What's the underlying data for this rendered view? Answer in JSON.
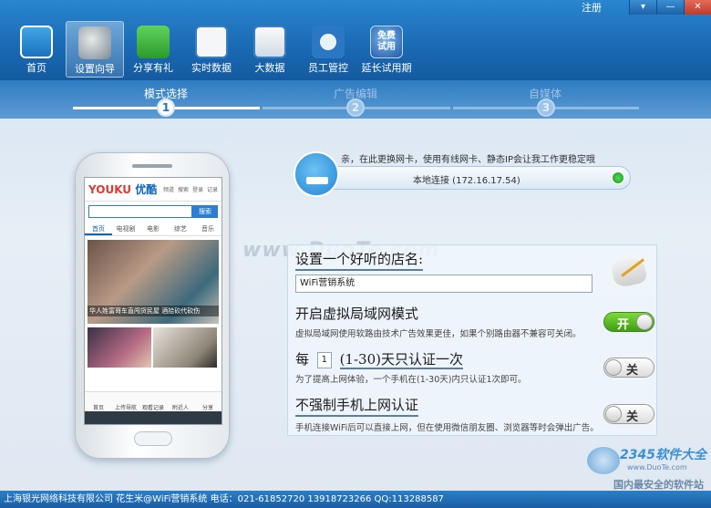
{
  "titlebar": {
    "register_label": "注册",
    "min_glyph": "▾",
    "max_glyph": "—",
    "close_glyph": "✕"
  },
  "toolbar": {
    "items": [
      {
        "label": "首页",
        "icon": "chart-icon"
      },
      {
        "label": "设置向导",
        "icon": "android-wizard-icon",
        "active": true
      },
      {
        "label": "分享有礼",
        "icon": "share-icon"
      },
      {
        "label": "实时数据",
        "icon": "table-icon"
      },
      {
        "label": "大数据",
        "icon": "magnifier-icon"
      },
      {
        "label": "员工管控",
        "icon": "staff-icon"
      },
      {
        "label": "延长试用期",
        "icon": "free-trial-icon",
        "badge": "免费\n试用"
      }
    ]
  },
  "steps": [
    {
      "label": "模式选择",
      "num": "1",
      "active": true
    },
    {
      "label": "广告编辑",
      "num": "2",
      "active": false
    },
    {
      "label": "自媒体",
      "num": "3",
      "active": false
    }
  ],
  "phone": {
    "logo_main": "YOUKU",
    "logo_sub": "优酷",
    "header_icons": [
      "频道",
      "搜索",
      "登录",
      "记录"
    ],
    "search_btn": "搜索",
    "nav": [
      "首页",
      "电视剧",
      "电影",
      "综艺",
      "音乐"
    ],
    "hero_caption": "华人姓富哥车直闯货民屋 酒拾砍代砍伤",
    "tabbar": [
      "首页",
      "上传导航",
      "观看记录",
      "附近人",
      "分享"
    ]
  },
  "network": {
    "message": "亲，在此更换网卡，使用有线网卡、静态IP会让我工作更稳定哦",
    "adapter": "本地连接 (172.16.17.54)"
  },
  "settings": {
    "shop_title": "设置一个好听的店名:",
    "shop_name": "WiFi营销系统",
    "vlan_title": "开启虚拟局域网模式",
    "vlan_desc": "虚拟局域网使用软路由技术广告效果更佳，如果个别路由器不兼容可关闭。",
    "vlan_state": "开",
    "auth_prefix": "每",
    "auth_days": "1",
    "auth_suffix": "(1-30)天只认证一次",
    "auth_desc": "为了提高上网体验，一个手机在(1-30天)内只认证1次即可。",
    "auth_state": "关",
    "noforce_title": "不强制手机上网认证",
    "noforce_desc": "手机连接WiFi后可以直接上网，但在使用微信朋友圈、浏览器等时会弹出广告。",
    "noforce_state": "关"
  },
  "watermarks": {
    "center": "www.DuoTe.com",
    "corner_big": "2345软件大全",
    "corner_url": "www.DuoTe.com",
    "corner_slogan": "国内最安全的软件站"
  },
  "statusbar": {
    "text": "上海银光网络科技有限公司 花生米@WiFi营销系统  电话：021-61852720    13918723266    QQ:113288587"
  },
  "colors": {
    "toolbar": "#1b6bb5",
    "toggle_on": "#5cbf24",
    "panel_border": "#c7d8e8"
  }
}
